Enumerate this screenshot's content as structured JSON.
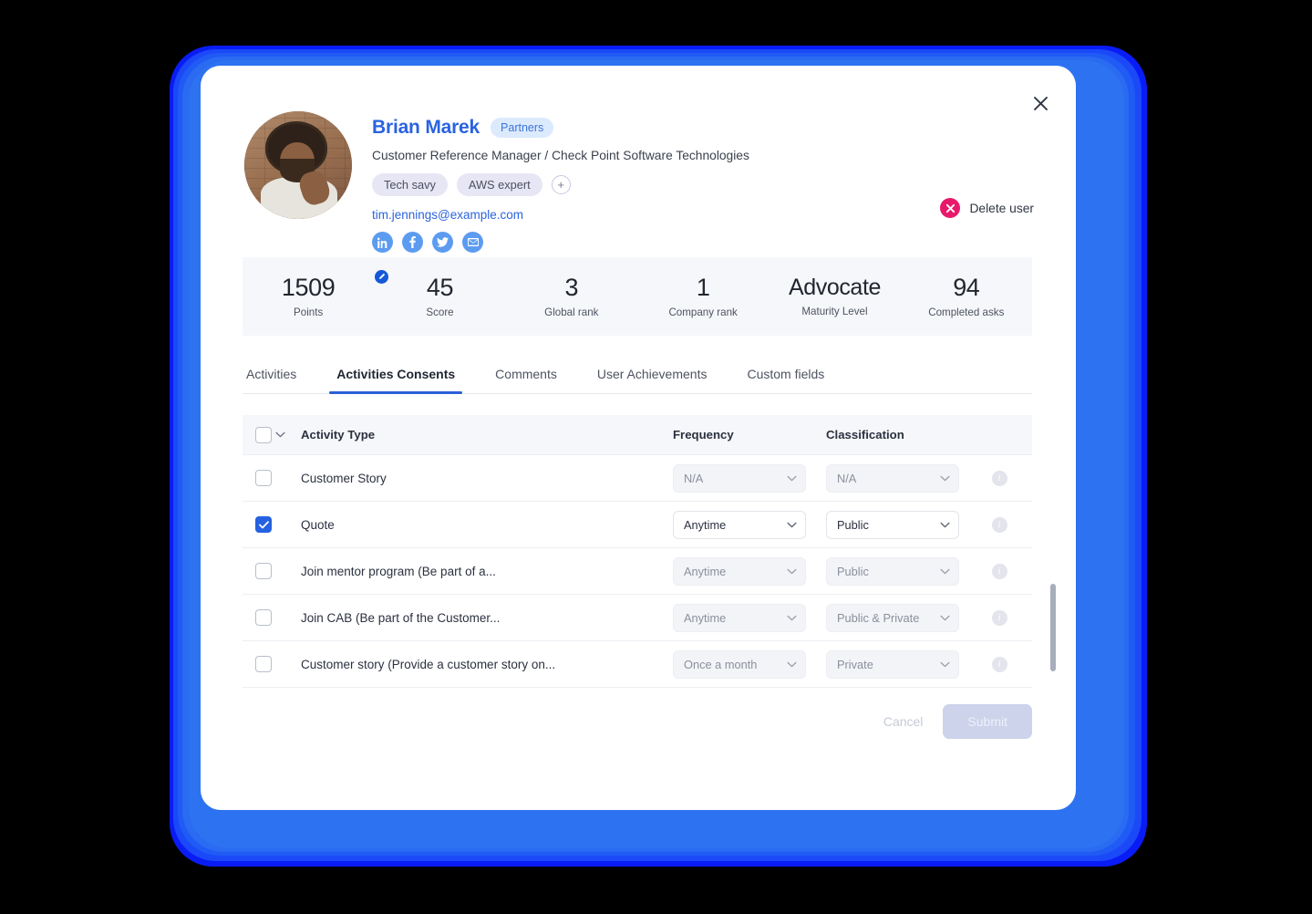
{
  "window": {
    "close_label": "×"
  },
  "profile": {
    "name": "Brian Marek",
    "badge": "Partners",
    "title": "Customer Reference Manager / Check Point Software Technologies",
    "tags": [
      "Tech savy",
      "AWS expert"
    ],
    "add_tag_label": "+",
    "email": "tim.jennings@example.com",
    "socials": [
      "linkedin-icon",
      "facebook-icon",
      "twitter-icon",
      "email-icon"
    ],
    "avatar_alt": "user-avatar"
  },
  "delete_user": {
    "label": "Delete user",
    "icon_color": "#e8196b"
  },
  "stats": [
    {
      "value": "1509",
      "label": "Points",
      "has_edit_badge": true
    },
    {
      "value": "45",
      "label": "Score",
      "has_edit_badge": false
    },
    {
      "value": "3",
      "label": "Global rank",
      "has_edit_badge": false
    },
    {
      "value": "1",
      "label": "Company rank",
      "has_edit_badge": false
    },
    {
      "value": "Advocate",
      "label": "Maturity Level",
      "has_edit_badge": false
    },
    {
      "value": "94",
      "label": "Completed asks",
      "has_edit_badge": false
    }
  ],
  "tabs": [
    {
      "label": "Activities",
      "active": false
    },
    {
      "label": "Activities Consents",
      "active": true
    },
    {
      "label": "Comments",
      "active": false
    },
    {
      "label": "User Achievements",
      "active": false
    },
    {
      "label": "Custom fields",
      "active": false
    }
  ],
  "table": {
    "headers": {
      "activity_type": "Activity Type",
      "frequency": "Frequency",
      "classification": "Classification"
    },
    "rows": [
      {
        "checked": false,
        "activity_type": "Customer Story",
        "frequency": "N/A",
        "classification": "N/A",
        "muted": true
      },
      {
        "checked": true,
        "activity_type": "Quote",
        "frequency": "Anytime",
        "classification": "Public",
        "muted": false
      },
      {
        "checked": false,
        "activity_type": "Join mentor program (Be part of a...",
        "frequency": "Anytime",
        "classification": "Public",
        "muted": true
      },
      {
        "checked": false,
        "activity_type": "Join CAB (Be part of the Customer...",
        "frequency": "Anytime",
        "classification": "Public & Private",
        "muted": true
      },
      {
        "checked": false,
        "activity_type": "Customer story (Provide a customer story on...",
        "frequency": "Once a month",
        "classification": "Private",
        "muted": true
      }
    ]
  },
  "footer": {
    "cancel_label": "Cancel",
    "submit_label": "Submit"
  },
  "colors": {
    "accent_blue": "#2a63e0",
    "glow_blue": "#2c72f1",
    "delete_pink": "#e8196b",
    "checkbox_blue": "#2561e0",
    "tab_underline": "#2a5fd6"
  }
}
